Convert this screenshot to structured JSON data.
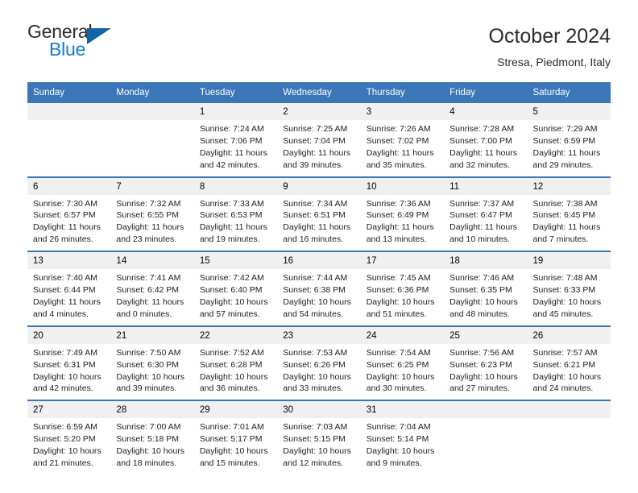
{
  "logo": {
    "line1": "General",
    "line2": "Blue",
    "triangle_icon": "blue-triangle-icon",
    "color_dark": "#2b2b2b",
    "color_blue": "#1a7bc4",
    "triangle_color": "#1464a5"
  },
  "header": {
    "title": "October 2024",
    "subtitle": "Stresa, Piedmont, Italy"
  },
  "colors": {
    "header_blue": "#3a76b8",
    "daynum_band": "#f0f0f0",
    "text": "#1d1d1d",
    "cell_background": "#ffffff"
  },
  "weekday_headers": [
    "Sunday",
    "Monday",
    "Tuesday",
    "Wednesday",
    "Thursday",
    "Friday",
    "Saturday"
  ],
  "weeks": [
    [
      {
        "day": "",
        "sunrise": "",
        "sunset": "",
        "daylight": "",
        "empty": true
      },
      {
        "day": "",
        "sunrise": "",
        "sunset": "",
        "daylight": "",
        "empty": true
      },
      {
        "day": "1",
        "sunrise": "Sunrise: 7:24 AM",
        "sunset": "Sunset: 7:06 PM",
        "daylight": "Daylight: 11 hours and 42 minutes."
      },
      {
        "day": "2",
        "sunrise": "Sunrise: 7:25 AM",
        "sunset": "Sunset: 7:04 PM",
        "daylight": "Daylight: 11 hours and 39 minutes."
      },
      {
        "day": "3",
        "sunrise": "Sunrise: 7:26 AM",
        "sunset": "Sunset: 7:02 PM",
        "daylight": "Daylight: 11 hours and 35 minutes."
      },
      {
        "day": "4",
        "sunrise": "Sunrise: 7:28 AM",
        "sunset": "Sunset: 7:00 PM",
        "daylight": "Daylight: 11 hours and 32 minutes."
      },
      {
        "day": "5",
        "sunrise": "Sunrise: 7:29 AM",
        "sunset": "Sunset: 6:59 PM",
        "daylight": "Daylight: 11 hours and 29 minutes."
      }
    ],
    [
      {
        "day": "6",
        "sunrise": "Sunrise: 7:30 AM",
        "sunset": "Sunset: 6:57 PM",
        "daylight": "Daylight: 11 hours and 26 minutes."
      },
      {
        "day": "7",
        "sunrise": "Sunrise: 7:32 AM",
        "sunset": "Sunset: 6:55 PM",
        "daylight": "Daylight: 11 hours and 23 minutes."
      },
      {
        "day": "8",
        "sunrise": "Sunrise: 7:33 AM",
        "sunset": "Sunset: 6:53 PM",
        "daylight": "Daylight: 11 hours and 19 minutes."
      },
      {
        "day": "9",
        "sunrise": "Sunrise: 7:34 AM",
        "sunset": "Sunset: 6:51 PM",
        "daylight": "Daylight: 11 hours and 16 minutes."
      },
      {
        "day": "10",
        "sunrise": "Sunrise: 7:36 AM",
        "sunset": "Sunset: 6:49 PM",
        "daylight": "Daylight: 11 hours and 13 minutes."
      },
      {
        "day": "11",
        "sunrise": "Sunrise: 7:37 AM",
        "sunset": "Sunset: 6:47 PM",
        "daylight": "Daylight: 11 hours and 10 minutes."
      },
      {
        "day": "12",
        "sunrise": "Sunrise: 7:38 AM",
        "sunset": "Sunset: 6:45 PM",
        "daylight": "Daylight: 11 hours and 7 minutes."
      }
    ],
    [
      {
        "day": "13",
        "sunrise": "Sunrise: 7:40 AM",
        "sunset": "Sunset: 6:44 PM",
        "daylight": "Daylight: 11 hours and 4 minutes."
      },
      {
        "day": "14",
        "sunrise": "Sunrise: 7:41 AM",
        "sunset": "Sunset: 6:42 PM",
        "daylight": "Daylight: 11 hours and 0 minutes."
      },
      {
        "day": "15",
        "sunrise": "Sunrise: 7:42 AM",
        "sunset": "Sunset: 6:40 PM",
        "daylight": "Daylight: 10 hours and 57 minutes."
      },
      {
        "day": "16",
        "sunrise": "Sunrise: 7:44 AM",
        "sunset": "Sunset: 6:38 PM",
        "daylight": "Daylight: 10 hours and 54 minutes."
      },
      {
        "day": "17",
        "sunrise": "Sunrise: 7:45 AM",
        "sunset": "Sunset: 6:36 PM",
        "daylight": "Daylight: 10 hours and 51 minutes."
      },
      {
        "day": "18",
        "sunrise": "Sunrise: 7:46 AM",
        "sunset": "Sunset: 6:35 PM",
        "daylight": "Daylight: 10 hours and 48 minutes."
      },
      {
        "day": "19",
        "sunrise": "Sunrise: 7:48 AM",
        "sunset": "Sunset: 6:33 PM",
        "daylight": "Daylight: 10 hours and 45 minutes."
      }
    ],
    [
      {
        "day": "20",
        "sunrise": "Sunrise: 7:49 AM",
        "sunset": "Sunset: 6:31 PM",
        "daylight": "Daylight: 10 hours and 42 minutes."
      },
      {
        "day": "21",
        "sunrise": "Sunrise: 7:50 AM",
        "sunset": "Sunset: 6:30 PM",
        "daylight": "Daylight: 10 hours and 39 minutes."
      },
      {
        "day": "22",
        "sunrise": "Sunrise: 7:52 AM",
        "sunset": "Sunset: 6:28 PM",
        "daylight": "Daylight: 10 hours and 36 minutes."
      },
      {
        "day": "23",
        "sunrise": "Sunrise: 7:53 AM",
        "sunset": "Sunset: 6:26 PM",
        "daylight": "Daylight: 10 hours and 33 minutes."
      },
      {
        "day": "24",
        "sunrise": "Sunrise: 7:54 AM",
        "sunset": "Sunset: 6:25 PM",
        "daylight": "Daylight: 10 hours and 30 minutes."
      },
      {
        "day": "25",
        "sunrise": "Sunrise: 7:56 AM",
        "sunset": "Sunset: 6:23 PM",
        "daylight": "Daylight: 10 hours and 27 minutes."
      },
      {
        "day": "26",
        "sunrise": "Sunrise: 7:57 AM",
        "sunset": "Sunset: 6:21 PM",
        "daylight": "Daylight: 10 hours and 24 minutes."
      }
    ],
    [
      {
        "day": "27",
        "sunrise": "Sunrise: 6:59 AM",
        "sunset": "Sunset: 5:20 PM",
        "daylight": "Daylight: 10 hours and 21 minutes."
      },
      {
        "day": "28",
        "sunrise": "Sunrise: 7:00 AM",
        "sunset": "Sunset: 5:18 PM",
        "daylight": "Daylight: 10 hours and 18 minutes."
      },
      {
        "day": "29",
        "sunrise": "Sunrise: 7:01 AM",
        "sunset": "Sunset: 5:17 PM",
        "daylight": "Daylight: 10 hours and 15 minutes."
      },
      {
        "day": "30",
        "sunrise": "Sunrise: 7:03 AM",
        "sunset": "Sunset: 5:15 PM",
        "daylight": "Daylight: 10 hours and 12 minutes."
      },
      {
        "day": "31",
        "sunrise": "Sunrise: 7:04 AM",
        "sunset": "Sunset: 5:14 PM",
        "daylight": "Daylight: 10 hours and 9 minutes."
      },
      {
        "day": "",
        "sunrise": "",
        "sunset": "",
        "daylight": "",
        "empty": true
      },
      {
        "day": "",
        "sunrise": "",
        "sunset": "",
        "daylight": "",
        "empty": true
      }
    ]
  ]
}
